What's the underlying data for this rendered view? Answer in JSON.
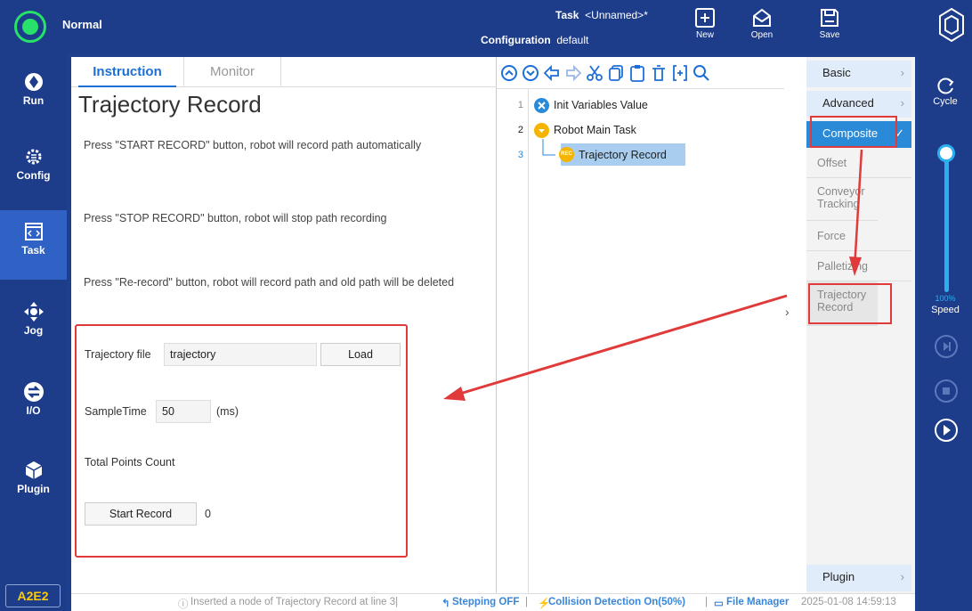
{
  "topbar": {
    "status": "Normal",
    "task_label": "Task",
    "task_value": "<Unnamed>*",
    "config_label": "Configuration",
    "config_value": "default",
    "new_label": "New",
    "open_label": "Open",
    "save_label": "Save"
  },
  "leftnav": {
    "run": "Run",
    "config": "Config",
    "task": "Task",
    "jog": "Jog",
    "io": "I/O",
    "plugin": "Plugin",
    "device": "A2E2"
  },
  "left_panel": {
    "tab_instruction": "Instruction",
    "tab_monitor": "Monitor",
    "title": "Trajectory Record",
    "instr1": "Press \"START RECORD\" button, robot will record path automatically",
    "instr2": "Press \"STOP RECORD\" button, robot will stop path recording",
    "instr3": "Press \"Re-record\" button, robot will record path and old path will be deleted",
    "traj_file_label": "Trajectory file",
    "traj_file_value": "trajectory",
    "load_label": "Load",
    "sample_label": "SampleTime",
    "sample_value": "50",
    "sample_unit": "(ms)",
    "total_label": "Total Points Count",
    "start_label": "Start Record",
    "count_value": "0"
  },
  "tree": {
    "nodes": [
      {
        "line": "1",
        "label": "Init Variables Value"
      },
      {
        "line": "2",
        "label": "Robot Main Task"
      },
      {
        "line": "3",
        "label": "Trajectory Record",
        "badge": "REC"
      }
    ]
  },
  "right_panel": {
    "basic": "Basic",
    "advanced": "Advanced",
    "composite": "Composite",
    "items": [
      "Offset",
      "Conveyor Tracking",
      "Force",
      "Palletizing",
      "Trajectory Record"
    ],
    "plugin": "Plugin"
  },
  "statusbar": {
    "message": "Inserted a node of  Trajectory Record at line 3|",
    "stepping": "Stepping OFF",
    "collision": "Collision Detection On(50%)",
    "file_manager": "File Manager",
    "timestamp": "2025-01-08 14:59:13"
  },
  "rightbar": {
    "cycle": "Cycle",
    "speed_value": "100%",
    "speed_label": "Speed",
    "speed_fraction": 1.0
  },
  "colors": {
    "navy": "#1d3c8a",
    "accent": "#2a8ad8",
    "status_green": "#27e16a",
    "annotation_red": "#e03a3a"
  }
}
